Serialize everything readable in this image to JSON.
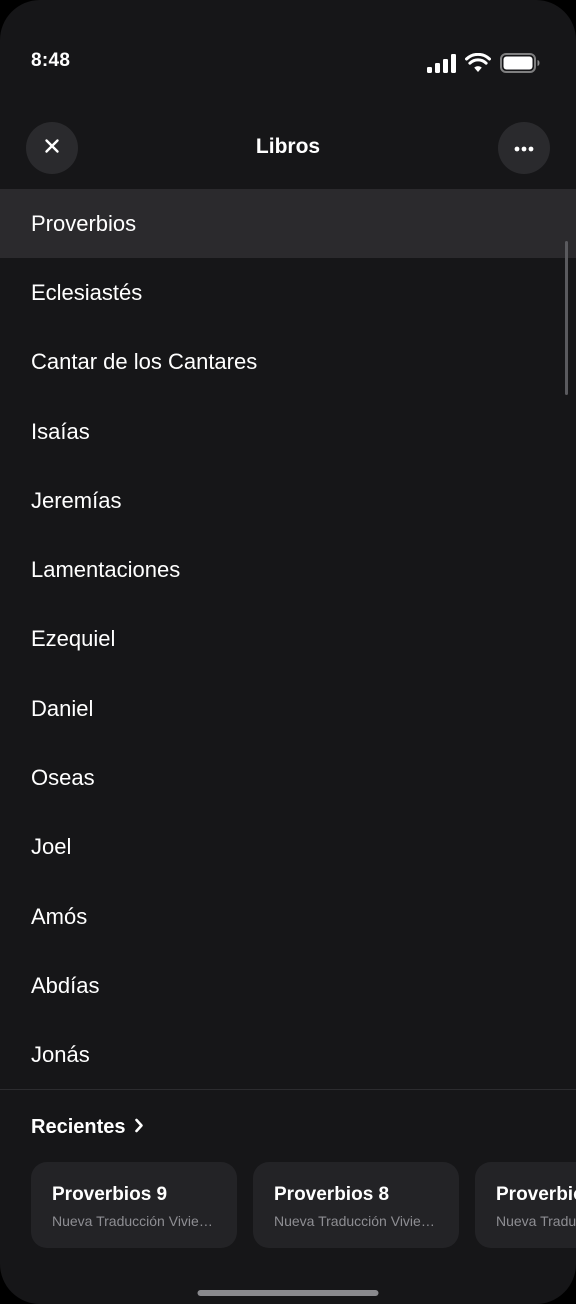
{
  "status_bar": {
    "time": "8:48",
    "icons": [
      "cellular-signal-icon",
      "wifi-icon",
      "battery-icon"
    ]
  },
  "header": {
    "title": "Libros",
    "close_icon": "close-icon",
    "more_icon": "more-icon"
  },
  "books": {
    "selected": "Proverbios",
    "items": [
      "Proverbios",
      "Eclesiastés",
      "Cantar de los Cantares",
      "Isaías",
      "Jeremías",
      "Lamentaciones",
      "Ezequiel",
      "Daniel",
      "Oseas",
      "Joel",
      "Amós",
      "Abdías",
      "Jonás"
    ]
  },
  "recents": {
    "title": "Recientes",
    "chevron_icon": "chevron-right-icon",
    "cards": [
      {
        "title": "Proverbios 9",
        "subtitle": "Nueva Traducción Viviente"
      },
      {
        "title": "Proverbios 8",
        "subtitle": "Nueva Traducción Viviente"
      },
      {
        "title": "Proverbios",
        "subtitle": "Nueva Traducción Viviente"
      }
    ]
  },
  "colors": {
    "background": "#161618",
    "selected_row": "#2b2a2d",
    "card": "#232326",
    "secondary_text": "#8e8e93"
  }
}
